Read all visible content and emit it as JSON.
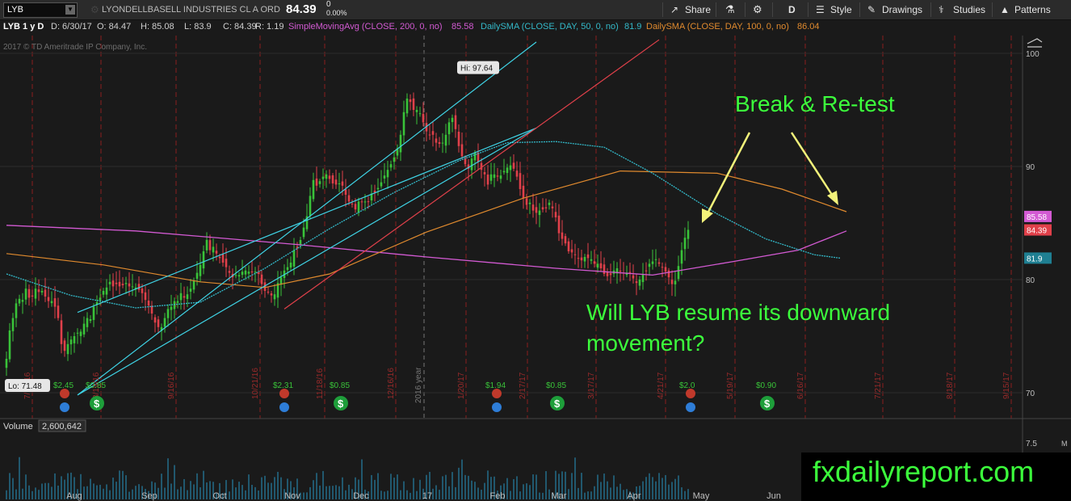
{
  "toolbar": {
    "symbol": "LYB",
    "company": "LYONDELLBASELL INDUSTRIES CL A ORD",
    "last": "84.39",
    "change": "0",
    "change_pct": "0.00%",
    "share": "Share",
    "aggregation": "D",
    "style": "Style",
    "drawings": "Drawings",
    "studies": "Studies",
    "patterns": "Patterns"
  },
  "infobar": {
    "period": "LYB 1 y D",
    "date": "D: 6/30/17",
    "open": "O: 84.47",
    "high": "H: 85.08",
    "low": "L: 83.9",
    "close": "C: 84.39",
    "range": "R: 1.19",
    "sma200": "SimpleMovingAvg (CLOSE, 200, 0, no)",
    "sma200_val": "85.58",
    "sma50": "DailySMA (CLOSE, DAY, 50, 0, no)",
    "sma50_val": "81.9",
    "sma100": "DailySMA (CLOSE, DAY, 100, 0, no)",
    "sma100_val": "86.04"
  },
  "colors": {
    "up": "#39c339",
    "down": "#e0404a",
    "sma200": "#d35ad3",
    "sma50": "#33b9c9",
    "sma100": "#e08a2e",
    "channel": "#3fd4e6",
    "trendline": "#e0404a",
    "annotation": "#3cff3c"
  },
  "watermark": "2017 © TD Ameritrade IP Company, Inc.",
  "brand": "fxdailyreport.com",
  "chart_data": {
    "type": "candlestick",
    "title": "LYB 1 y D",
    "price_range": [
      68.5,
      102
    ],
    "y_ticks": [
      70,
      80,
      90,
      100
    ],
    "month_labels": [
      "Aug",
      "Sep",
      "Oct",
      "Nov",
      "Dec",
      "17",
      "Feb",
      "Mar",
      "Apr",
      "May",
      "Jun"
    ],
    "expiry_labels": [
      "7/15/16",
      "8/19/16",
      "9/16/16",
      "10/21/16",
      "11/18/16",
      "12/16/16",
      "1/20/17",
      "2/17/17",
      "3/17/17",
      "4/21/17",
      "5/19/17",
      "6/16/17",
      "7/21/17",
      "8/18/17",
      "9/15/17"
    ],
    "year_label": "2016 year",
    "hi_label": "Hi: 97.64",
    "lo_label": "Lo: 71.48",
    "last_price_label": "84.39",
    "sma200_label": "85.58",
    "sma50_label": "81.9",
    "dividends": [
      "$2.45",
      "$0.85",
      "$2.31",
      "$0.85",
      "$1.94",
      "$0.85",
      "$2.0",
      "$0.90"
    ],
    "volume": {
      "label": "Volume",
      "value": "2,600,642",
      "axis_tick": "7.5",
      "unit": "M"
    },
    "sma200_path": [
      [
        0,
        84.8
      ],
      [
        40,
        84.3
      ],
      [
        90,
        83.1
      ],
      [
        130,
        82.0
      ],
      [
        170,
        81.0
      ],
      [
        200,
        80.4
      ],
      [
        225,
        81.6
      ],
      [
        245,
        82.6
      ],
      [
        260,
        84.3
      ]
    ],
    "sma50_path": [
      [
        0,
        80.5
      ],
      [
        20,
        78.6
      ],
      [
        40,
        77.5
      ],
      [
        60,
        78.0
      ],
      [
        80,
        81.0
      ],
      [
        100,
        84.5
      ],
      [
        120,
        87.7
      ],
      [
        140,
        90.5
      ],
      [
        155,
        92.1
      ],
      [
        170,
        92.2
      ],
      [
        185,
        91.7
      ],
      [
        200,
        89.4
      ],
      [
        220,
        85.8
      ],
      [
        235,
        83.6
      ],
      [
        250,
        82.2
      ],
      [
        258,
        81.9
      ]
    ],
    "sma100_path": [
      [
        0,
        82.3
      ],
      [
        30,
        81.3
      ],
      [
        60,
        79.8
      ],
      [
        80,
        79.3
      ],
      [
        100,
        80.5
      ],
      [
        130,
        84.2
      ],
      [
        160,
        87.2
      ],
      [
        190,
        89.6
      ],
      [
        220,
        89.4
      ],
      [
        240,
        88.0
      ],
      [
        260,
        86.0
      ]
    ],
    "closes": [
      73,
      75.5,
      76.6,
      77.9,
      78.3,
      78.2,
      79.2,
      78.4,
      78.5,
      79.2,
      78.9,
      79.0,
      78.5,
      78.1,
      78.1,
      77.6,
      76.6,
      74.3,
      73.7,
      74.3,
      74.7,
      75.0,
      75.3,
      75.4,
      76.1,
      76.6,
      76.5,
      77.6,
      78.0,
      78.4,
      79.0,
      79.3,
      79.8,
      79.4,
      79.6,
      79.4,
      79.5,
      79.7,
      79.4,
      79.4,
      79.3,
      79.1,
      78.8,
      78.2,
      77.7,
      77.0,
      76.2,
      75.8,
      75.8,
      76.6,
      77.4,
      77.6,
      78.1,
      78.1,
      78.8,
      78.4,
      78.7,
      79.2,
      79.9,
      80.6,
      81.3,
      82.5,
      83.5,
      82.6,
      82.9,
      82.3,
      81.9,
      81.5,
      81.1,
      80.6,
      80.2,
      80.4,
      80.4,
      80.7,
      80.8,
      80.7,
      80.7,
      80.7,
      80.5,
      79.6,
      79.0,
      78.9,
      78.6,
      78.7,
      79.7,
      80.2,
      80.8,
      81.1,
      81.5,
      82.6,
      82.8,
      83.5,
      84.6,
      85.6,
      87.4,
      88.8,
      88.3,
      88.7,
      89.1,
      89.3,
      88.9,
      88.5,
      88.4,
      88.5,
      88.3,
      87.5,
      86.9,
      86.7,
      86.2,
      86.9,
      86.9,
      86.9,
      86.9,
      87.6,
      87.7,
      88.1,
      88.6,
      89.2,
      89.7,
      90.2,
      90.8,
      91.6,
      92.8,
      94.8,
      96.0,
      95.7,
      95.0,
      95.0,
      94.7,
      93.9,
      93.1,
      92.8,
      92.8,
      92.1,
      92.0,
      92.1,
      92.8,
      93.9,
      94.3,
      93.3,
      91.8,
      90.9,
      90.2,
      89.8,
      90.7,
      91.2,
      90.4,
      89.7,
      89.3,
      88.4,
      89.3,
      89.3,
      89.1,
      89.2,
      89.6,
      89.9,
      90.1,
      89.8,
      89.1,
      88.0,
      87.2,
      86.6,
      86.8,
      86.1,
      85.9,
      86.1,
      86.2,
      86.3,
      86.8,
      86.3,
      85.5,
      84.1,
      83.6,
      83.2,
      82.5,
      82.4,
      82.2,
      81.9,
      81.7,
      82.0,
      81.9,
      81.8,
      81.4,
      81.4,
      81.0,
      80.5,
      80.3,
      80.4,
      80.8,
      81.0,
      80.7,
      80.6,
      80.6,
      80.6,
      80.1,
      79.7,
      80.0,
      80.5,
      80.8,
      81.4,
      81.6,
      81.8,
      81.4,
      81.1,
      80.7,
      80.2,
      79.6,
      79.9,
      81.2,
      82.6,
      83.7,
      84.4
    ]
  },
  "annotations": {
    "break_retest": "Break & Re-test",
    "question_line1": "Will LYB resume its downward",
    "question_line2": "movement?"
  }
}
